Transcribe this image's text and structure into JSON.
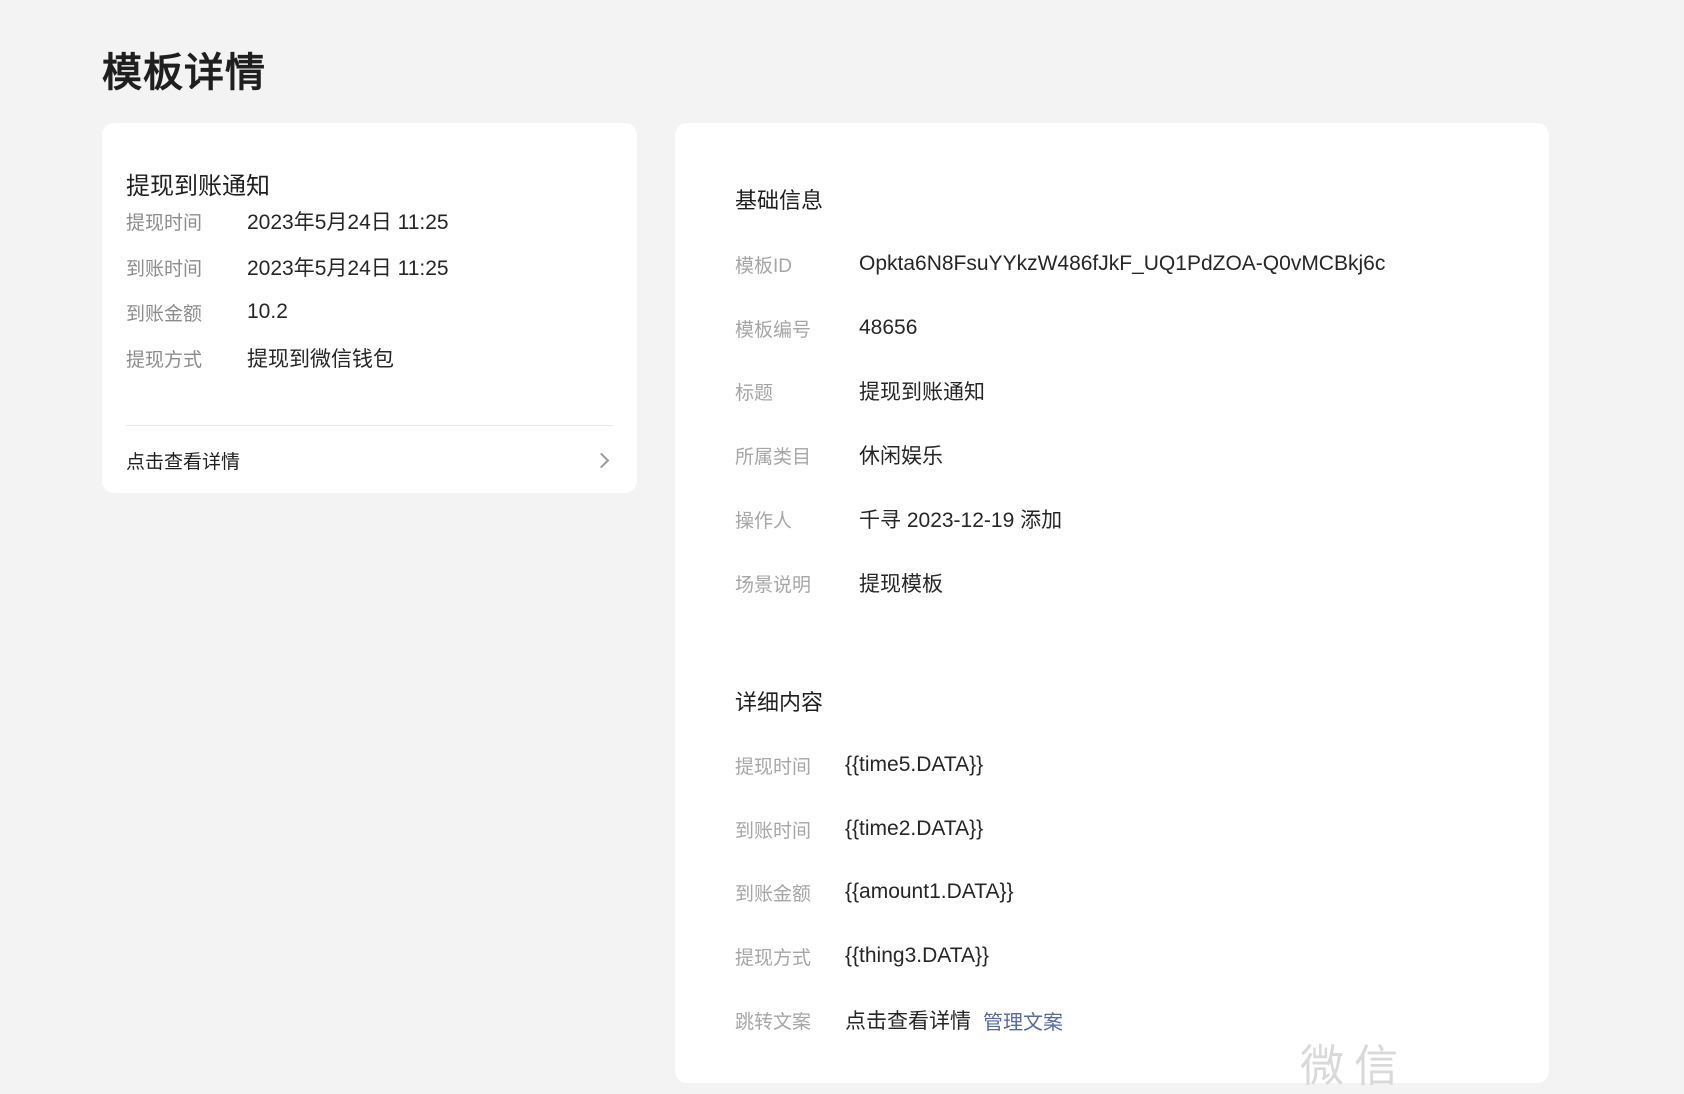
{
  "page": {
    "title": "模板详情"
  },
  "preview": {
    "title": "提现到账通知",
    "rows": [
      {
        "label": "提现时间",
        "value": "2023年5月24日 11:25"
      },
      {
        "label": "到账时间",
        "value": "2023年5月24日 11:25"
      },
      {
        "label": "到账金额",
        "value": "10.2"
      },
      {
        "label": "提现方式",
        "value": "提现到微信钱包"
      }
    ],
    "link_text": "点击查看详情"
  },
  "basic_info": {
    "section_title": "基础信息",
    "rows": [
      {
        "label": "模板ID",
        "value": "Opkta6N8FsuYYkzW486fJkF_UQ1PdZOA-Q0vMCBkj6c"
      },
      {
        "label": "模板编号",
        "value": "48656"
      },
      {
        "label": "标题",
        "value": "提现到账通知"
      },
      {
        "label": "所属类目",
        "value": "休闲娱乐"
      },
      {
        "label": "操作人",
        "value": "千寻 2023-12-19 添加"
      },
      {
        "label": "场景说明",
        "value": "提现模板"
      }
    ]
  },
  "detail_content": {
    "section_title": "详细内容",
    "rows": [
      {
        "label": "提现时间",
        "value": "{{time5.DATA}}"
      },
      {
        "label": "到账时间",
        "value": "{{time2.DATA}}"
      },
      {
        "label": "到账金额",
        "value": "{{amount1.DATA}}"
      },
      {
        "label": "提现方式",
        "value": "{{thing3.DATA}}"
      }
    ],
    "jump": {
      "label": "跳转文案",
      "value": "点击查看详情",
      "manage_link": "管理文案"
    }
  },
  "watermark": "微信"
}
